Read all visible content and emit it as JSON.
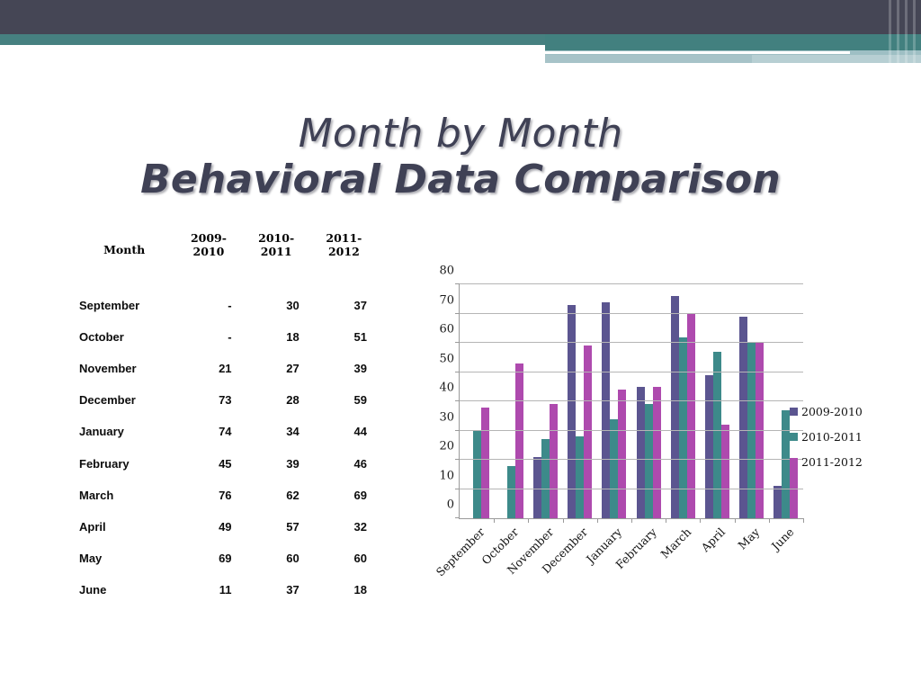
{
  "banner": {
    "dark_color": "#454655",
    "teal_color": "#468080",
    "light_color": "#a7c3c8"
  },
  "title": {
    "line1": "Month by Month",
    "line2": "Behavioral Data Comparison"
  },
  "table": {
    "headers": [
      "Month",
      "2009-2010",
      "2010-2011",
      "2011-2012"
    ],
    "headers_display": [
      [
        "Month"
      ],
      [
        "2009-",
        "2010"
      ],
      [
        "2010-",
        "2011"
      ],
      [
        "2011-",
        "2012"
      ]
    ],
    "rows": [
      {
        "month": "September",
        "v1": "-",
        "v2": "30",
        "v3": "37"
      },
      {
        "month": "October",
        "v1": "-",
        "v2": "18",
        "v3": "51"
      },
      {
        "month": "November",
        "v1": "21",
        "v2": "27",
        "v3": "39"
      },
      {
        "month": "December",
        "v1": "73",
        "v2": "28",
        "v3": "59"
      },
      {
        "month": "January",
        "v1": "74",
        "v2": "34",
        "v3": "44"
      },
      {
        "month": "February",
        "v1": "45",
        "v2": "39",
        "v3": "46"
      },
      {
        "month": "March",
        "v1": "76",
        "v2": "62",
        "v3": "69"
      },
      {
        "month": "April",
        "v1": "49",
        "v2": "57",
        "v3": "32"
      },
      {
        "month": "May",
        "v1": "69",
        "v2": "60",
        "v3": "60"
      },
      {
        "month": "June",
        "v1": "11",
        "v2": "37",
        "v3": "18"
      }
    ]
  },
  "chart_data": {
    "type": "bar",
    "title": "",
    "xlabel": "",
    "ylabel": "",
    "ylim": [
      0,
      80
    ],
    "yticks": [
      0,
      10,
      20,
      30,
      40,
      50,
      60,
      70,
      80
    ],
    "grid": true,
    "legend_position": "right",
    "categories": [
      "September",
      "October",
      "November",
      "December",
      "January",
      "February",
      "March",
      "April",
      "May",
      "June"
    ],
    "series": [
      {
        "name": "2009-2010",
        "color": "#5b5590",
        "values": [
          null,
          null,
          21,
          73,
          74,
          45,
          76,
          49,
          69,
          11
        ]
      },
      {
        "name": "2010-2011",
        "color": "#3d8a8a",
        "values": [
          30,
          18,
          27,
          28,
          34,
          39,
          62,
          57,
          60,
          37
        ]
      },
      {
        "name": "2011-2012",
        "color": "#ae4aae",
        "values": [
          38,
          53,
          39,
          59,
          44,
          45,
          70,
          32,
          60,
          18
        ]
      }
    ]
  }
}
